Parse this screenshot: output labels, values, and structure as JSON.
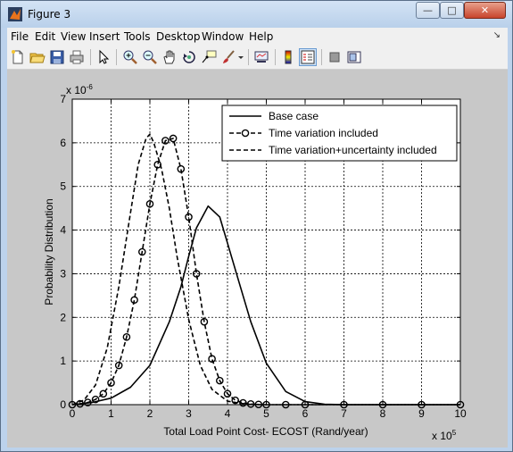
{
  "window": {
    "title": "Figure 3",
    "minimize_glyph": "—",
    "maximize_glyph": "□",
    "close_glyph": "✕"
  },
  "menu": [
    "File",
    "Edit",
    "View",
    "Insert",
    "Tools",
    "Desktop",
    "Window",
    "Help"
  ],
  "menu_overflow_glyph": "↘",
  "toolbar": [
    "new-figure-icon",
    "open-file-icon",
    "save-icon",
    "print-icon",
    "edit-plot-arrow-icon",
    "zoom-in-icon",
    "zoom-out-icon",
    "pan-hand-icon",
    "rotate-3d-icon",
    "data-cursor-icon",
    "brush-icon",
    "link-plot-icon",
    "colorbar-icon",
    "legend-icon",
    "hide-plot-tools-icon",
    "show-plot-tools-icon"
  ],
  "chart_data": {
    "type": "line",
    "xlabel": "Total Load Point Cost- ECOST (Rand/year)",
    "ylabel": "Probability Distribution",
    "x_multiplier": "x 10",
    "x_exponent": "5",
    "y_multiplier": "x 10",
    "y_exponent": "-6",
    "xlim": [
      0,
      10
    ],
    "ylim": [
      0,
      7
    ],
    "xticks": [
      "0",
      "1",
      "2",
      "3",
      "4",
      "5",
      "6",
      "7",
      "8",
      "9",
      "10"
    ],
    "yticks": [
      "0",
      "1",
      "2",
      "3",
      "4",
      "5",
      "6",
      "7"
    ],
    "grid": true,
    "legend_position": "top-right",
    "series": [
      {
        "name": "Base case",
        "style": "solid",
        "x": [
          0,
          0.5,
          1,
          1.5,
          2,
          2.5,
          2.8,
          3,
          3.2,
          3.5,
          3.8,
          4,
          4.3,
          4.6,
          5,
          5.5,
          6,
          6.5,
          7,
          10
        ],
        "y": [
          0,
          0.05,
          0.15,
          0.4,
          0.9,
          1.9,
          2.7,
          3.4,
          4.05,
          4.55,
          4.3,
          3.7,
          2.8,
          1.9,
          0.95,
          0.3,
          0.07,
          0.01,
          0,
          0
        ]
      },
      {
        "name": "Time variation included",
        "style": "dash-circle",
        "x": [
          0,
          0.2,
          0.4,
          0.6,
          0.8,
          1.0,
          1.2,
          1.4,
          1.6,
          1.8,
          2.0,
          2.2,
          2.4,
          2.6,
          2.8,
          3.0,
          3.2,
          3.4,
          3.6,
          3.8,
          4.0,
          4.2,
          4.4,
          4.6,
          4.8,
          5.0,
          5.5,
          6,
          7,
          8,
          9,
          10
        ],
        "y": [
          0,
          0.02,
          0.05,
          0.12,
          0.25,
          0.5,
          0.9,
          1.55,
          2.4,
          3.5,
          4.6,
          5.5,
          6.05,
          6.1,
          5.4,
          4.3,
          3.0,
          1.9,
          1.05,
          0.55,
          0.25,
          0.1,
          0.04,
          0.015,
          0.005,
          0,
          0,
          0,
          0,
          0,
          0,
          0
        ]
      },
      {
        "name": "Time variation+uncertainty included",
        "style": "dashed",
        "x": [
          0,
          0.3,
          0.6,
          0.9,
          1.2,
          1.5,
          1.7,
          1.9,
          2.0,
          2.1,
          2.3,
          2.5,
          2.7,
          3.0,
          3.3,
          3.6,
          4.0,
          4.5,
          5,
          10
        ],
        "y": [
          0,
          0.1,
          0.45,
          1.3,
          2.7,
          4.4,
          5.5,
          6.1,
          6.2,
          6.0,
          5.4,
          4.5,
          3.4,
          1.95,
          0.9,
          0.35,
          0.08,
          0.01,
          0,
          0
        ]
      }
    ]
  }
}
